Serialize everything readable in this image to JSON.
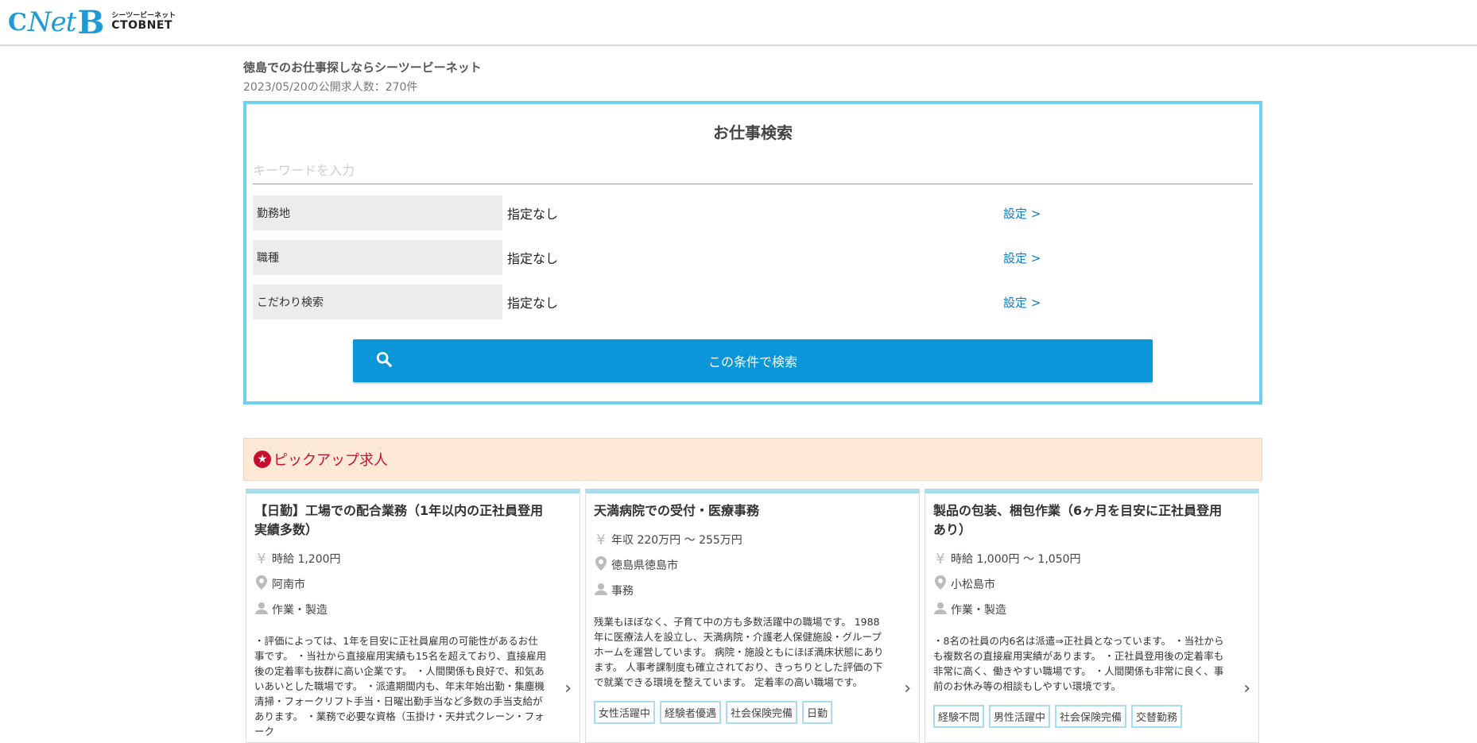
{
  "logo": {
    "mark": "Net",
    "kana": "シーツービーネット",
    "en": "CTOBNET"
  },
  "tagline": "徳島でのお仕事探しならシーツービーネット",
  "count": "2023/05/20の公開求人数：270件",
  "search": {
    "title": "お仕事検索",
    "placeholder": "キーワードを入力",
    "conditions": [
      {
        "label": "勤務地",
        "value": "指定なし",
        "link": "設定 >"
      },
      {
        "label": "職種",
        "value": "指定なし",
        "link": "設定 >"
      },
      {
        "label": "こだわり検索",
        "value": "指定なし",
        "link": "設定 >"
      }
    ],
    "button": "この条件で検索"
  },
  "pickup": {
    "title": "ピックアップ求人",
    "cards": [
      {
        "title": "【日勤】工場での配合業務（1年以内の正社員登用実績多数）",
        "salary": "時給 1,200円",
        "location": "阿南市",
        "category": "作業・製造",
        "desc": "・評価によっては、1年を目安に正社員雇用の可能性があるお仕事です。 ・当社から直接雇用実績も15名を超えており、直接雇用後の定着率も抜群に高い企業です。 ・人間関係も良好で、和気あいあいとした職場です。 ・派遣期間内も、年末年始出勤・集塵機清掃・フォークリフト手当・日曜出勤手当など多数の手当支給があります。 ・業務で必要な資格（玉掛け・天井式クレーン・フォーク",
        "tags": []
      },
      {
        "title": "天満病院での受付・医療事務",
        "salary": "年収 220万円 〜 255万円",
        "location": "徳島県徳島市",
        "category": "事務",
        "desc": "残業もほぼなく、子育て中の方も多数活躍中の職場です。 1988年に医療法人を設立し、天満病院・介護老人保健施設・グループホームを運営しています。 病院・施設ともにほぼ満床状態にあります。 人事考課制度も確立されており、きっちりとした評価の下で就業できる環境を整えています。 定着率の高い職場です。",
        "tags": [
          "女性活躍中",
          "経験者優遇",
          "社会保険完備",
          "日勤"
        ]
      },
      {
        "title": "製品の包装、梱包作業（6ヶ月を目安に正社員登用あり）",
        "salary": "時給 1,000円 〜 1,050円",
        "location": "小松島市",
        "category": "作業・製造",
        "desc": "・8名の社員の内6名は派遣⇒正社員となっています。 ・当社からも複数名の直接雇用実績があります。 ・正社員登用後の定着率も非常に高く、働きやすい職場です。 ・人間関係も非常に良く、事前のお休み等の相談もしやすい環境です。",
        "tags": [
          "経験不問",
          "男性活躍中",
          "社会保険完備",
          "交替勤務"
        ]
      }
    ]
  }
}
